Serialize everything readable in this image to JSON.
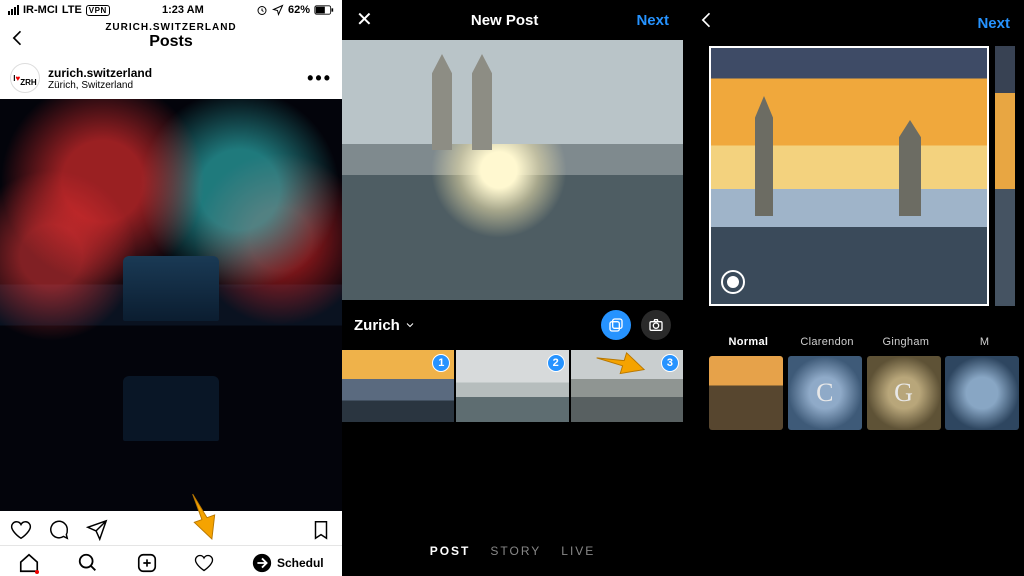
{
  "panel1": {
    "status": {
      "carrier": "IR-MCI",
      "net": "LTE",
      "vpn": "VPN",
      "time": "1:23 AM",
      "battery": "62%"
    },
    "header": {
      "context": "ZURICH.SWITZERLAND",
      "title": "Posts"
    },
    "post": {
      "username": "zurich.switzerland",
      "location": "Zürich, Switzerland"
    },
    "tabbar": {
      "schedule_label": "Schedul"
    }
  },
  "panel2": {
    "header": {
      "title": "New Post",
      "next": "Next"
    },
    "album": "Zurich",
    "thumbs": [
      {
        "n": "1"
      },
      {
        "n": "2"
      },
      {
        "n": "3"
      }
    ],
    "modes": {
      "post": "POST",
      "story": "STORY",
      "live": "LIVE"
    }
  },
  "panel3": {
    "header": {
      "next": "Next"
    },
    "filters": [
      {
        "label": "Normal",
        "letter": ""
      },
      {
        "label": "Clarendon",
        "letter": "C"
      },
      {
        "label": "Gingham",
        "letter": "G"
      },
      {
        "label": "M",
        "letter": ""
      }
    ]
  }
}
